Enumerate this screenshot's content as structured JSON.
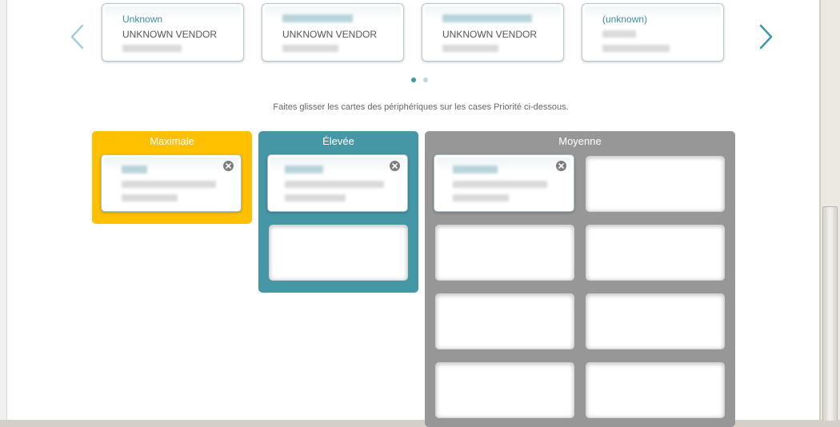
{
  "carousel": {
    "prev_icon": "chevron-left-icon",
    "next_icon": "chevron-right-icon",
    "accent": "#3d98a8",
    "cards": [
      {
        "name": "Unknown",
        "vendor": "UNKNOWN VENDOR"
      },
      {
        "name": "",
        "vendor": "UNKNOWN VENDOR"
      },
      {
        "name": "",
        "vendor": "UNKNOWN VENDOR"
      },
      {
        "name": "(unknown)",
        "vendor": ""
      }
    ],
    "page_count": 2,
    "current_page": 1
  },
  "instruction": "Faites glisser les cartes des périphériques sur les cases Priorité ci-dessous.",
  "priorities": {
    "max": {
      "title": "Maximale",
      "color": "#ffc000"
    },
    "high": {
      "title": "Élevée",
      "color": "#4597a6"
    },
    "mid": {
      "title": "Moyenne",
      "color": "#979797"
    }
  },
  "close_icon": "close-icon"
}
